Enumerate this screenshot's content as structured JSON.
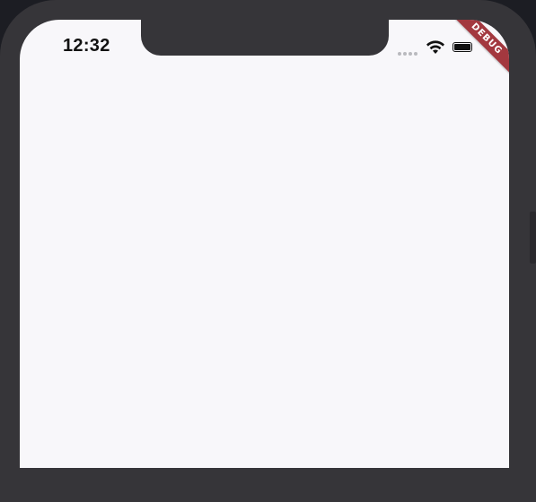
{
  "status_bar": {
    "time": "12:32",
    "signal_icon": "cellular-signal-icon",
    "wifi_icon": "wifi-icon",
    "battery_icon": "battery-icon"
  },
  "debug_banner": {
    "label": "DEBUG",
    "color": "#a3383f"
  },
  "colors": {
    "screen_background": "#f8f7fa",
    "device_frame": "#363539",
    "backdrop": "#1c1d23"
  }
}
